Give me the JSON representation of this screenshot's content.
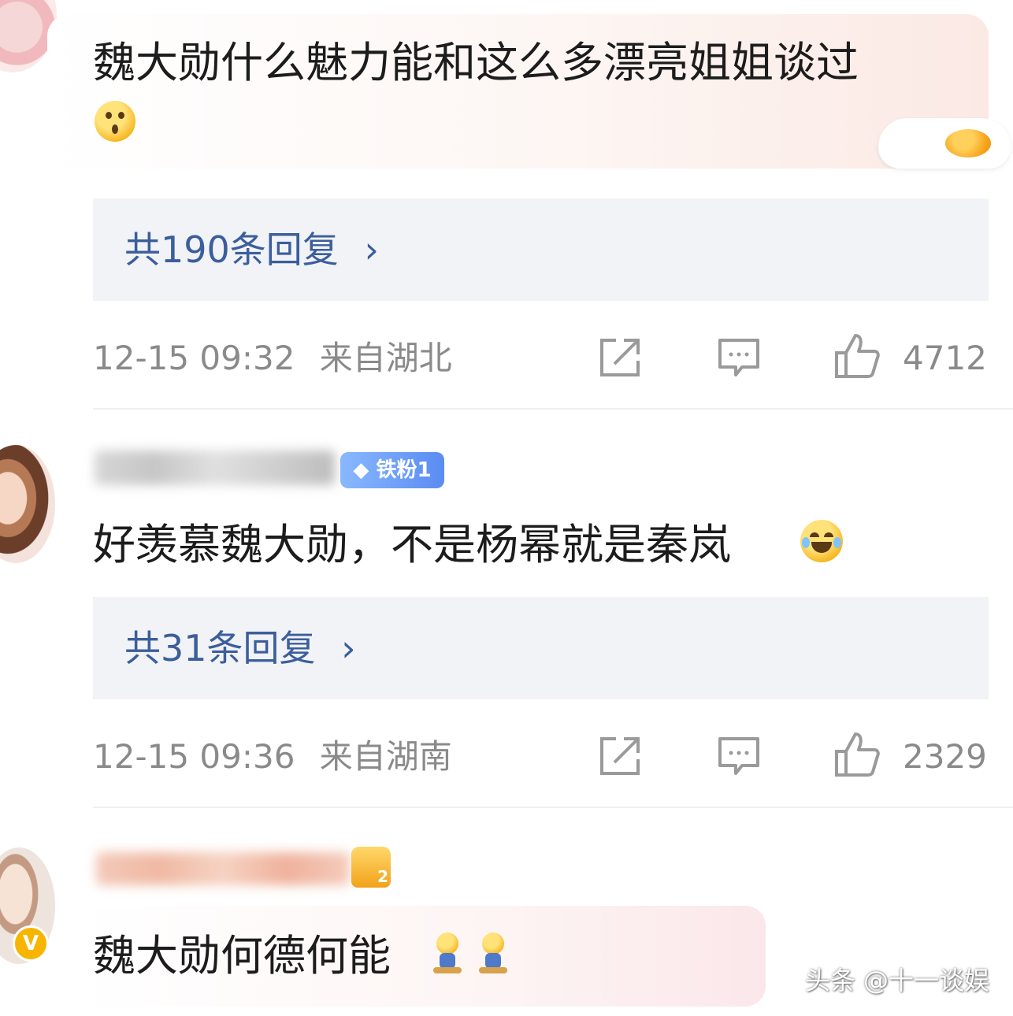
{
  "comments": [
    {
      "text": "魏大勋什么魅力能和这么多漂亮姐姐谈过",
      "reply_label": "共190条回复",
      "date": "12-15 09:32",
      "location": "来自湖北",
      "likes": "4712"
    },
    {
      "fan_badge": "铁粉1",
      "text": "好羡慕魏大勋，不是杨幂就是秦岚",
      "reply_label": "共31条回复",
      "date": "12-15 09:36",
      "location": "来自湖南",
      "likes": "2329"
    },
    {
      "text": "魏大勋何德何能",
      "crown_level": "2",
      "verified_mark": "V"
    }
  ],
  "icons": {
    "chevron": "›",
    "share": "share-icon",
    "comment": "comment-icon",
    "like": "thumbs-up-icon"
  },
  "watermark": "头条 @十一谈娱",
  "colors": {
    "reply_link": "#3b5e9c",
    "meta_gray": "#8a8a8a",
    "reply_bg": "#f2f3f6"
  }
}
